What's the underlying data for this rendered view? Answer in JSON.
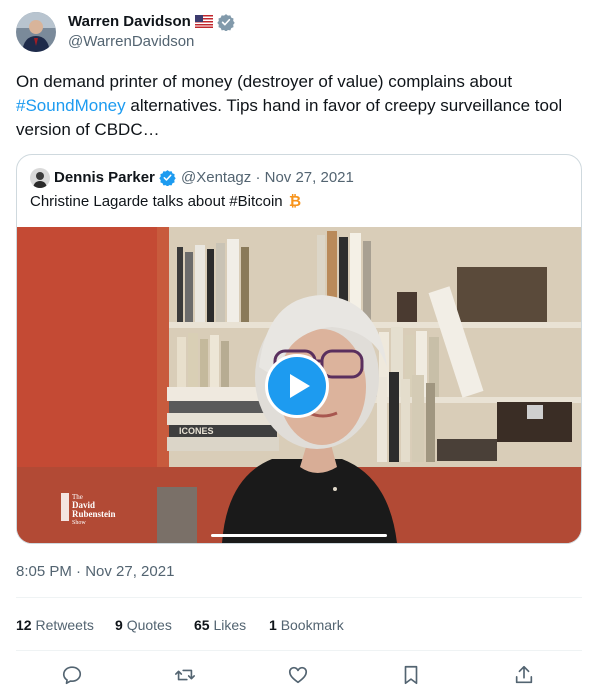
{
  "author": {
    "name": "Warren Davidson",
    "handle": "@WarrenDavidson",
    "flag_icon": "us-flag-icon",
    "verified_icon": "verified-badge-icon"
  },
  "tweet": {
    "text_before": "On demand printer of money (destroyer of value) complains about ",
    "hashtag": "#SoundMoney",
    "text_after": " alternatives. Tips hand in favor of creepy surveillance tool version of CBDC…"
  },
  "quote": {
    "name": "Dennis Parker",
    "handle": "@Xentagz",
    "separator": "·",
    "date": "Nov 27, 2021",
    "text": "Christine Lagarde talks about #Bitcoin",
    "video": {
      "logo_lines": [
        "The",
        "David",
        "Rubenstein",
        "Show"
      ],
      "book_label": "ICONES"
    }
  },
  "timestamp": "8:05 PM · Nov 27, 2021",
  "stats": {
    "retweets_count": "12",
    "retweets_label": "Retweets",
    "quotes_count": "9",
    "quotes_label": "Quotes",
    "likes_count": "65",
    "likes_label": "Likes",
    "bookmarks_count": "1",
    "bookmarks_label": "Bookmark"
  },
  "actions": [
    "reply-icon",
    "retweet-icon",
    "like-icon",
    "bookmark-icon",
    "share-icon"
  ],
  "colors": {
    "accent": "#1d9bf0",
    "text": "#0f1419",
    "secondary": "#536471",
    "bitcoin": "#f7931a"
  }
}
